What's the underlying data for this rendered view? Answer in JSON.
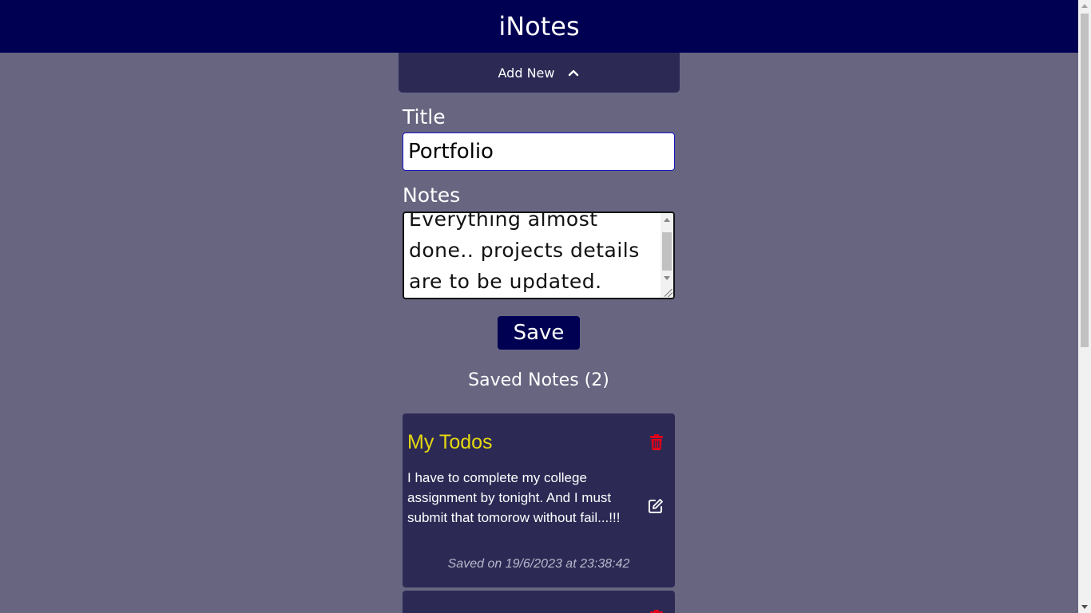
{
  "app": {
    "title": "iNotes"
  },
  "add_new": {
    "label": "Add New",
    "icon": "chevron-up-icon",
    "state": "expanded"
  },
  "form": {
    "title_label": "Title",
    "title_value": "Portfolio",
    "notes_label": "Notes",
    "notes_value": "Everything almost done.. projects details are to be updated.",
    "save_label": "Save"
  },
  "saved": {
    "heading": "Saved Notes (2)",
    "count": 2,
    "notes": [
      {
        "title": "My Todos",
        "body": "I have to complete my college assignment by tonight. And I must submit that tomorow without fail...!!!",
        "saved_on": "Saved on 19/6/2023 at 23:38:42"
      }
    ]
  },
  "colors": {
    "navbar": "#000053",
    "background": "#676580",
    "card": "#2c2a55",
    "note_title": "#e6d80f",
    "delete_icon": "#e0001a",
    "save_button": "#000053"
  }
}
